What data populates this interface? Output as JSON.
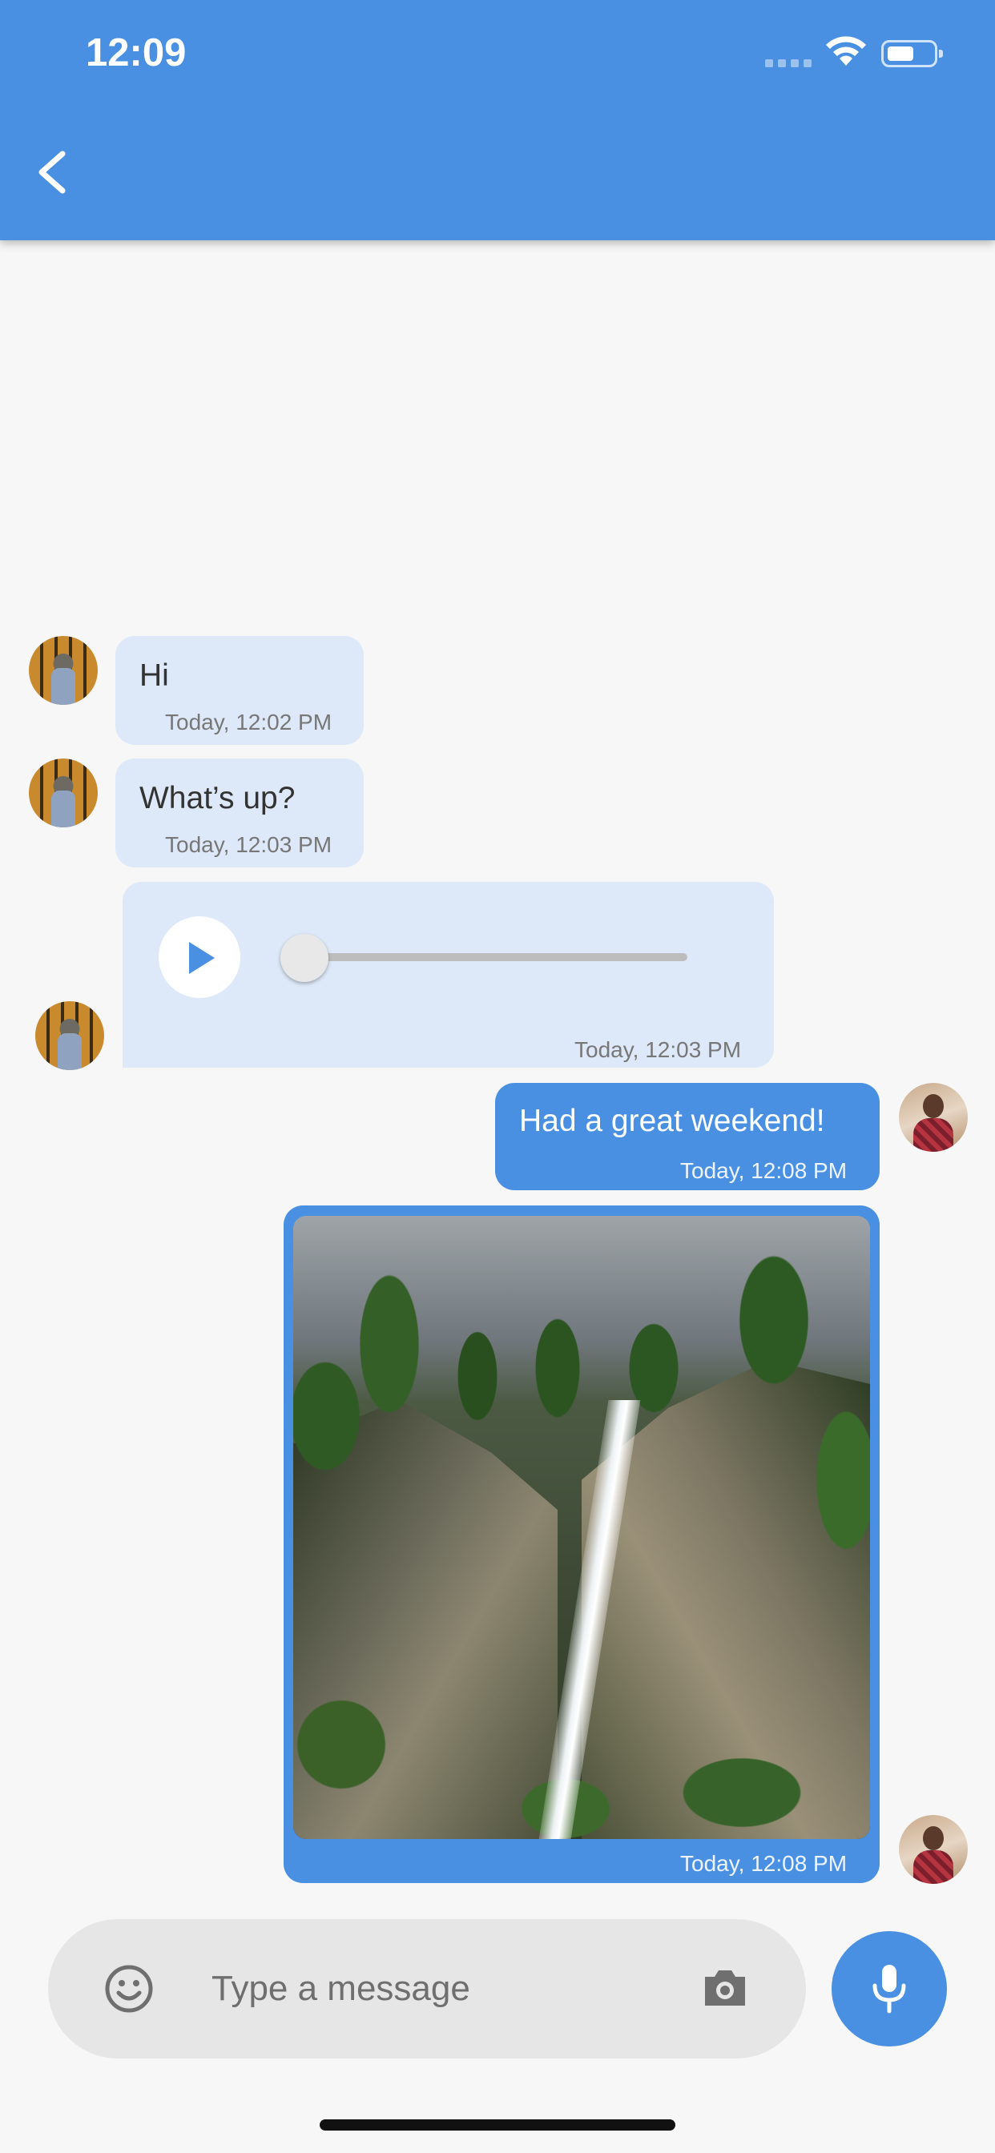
{
  "status_bar": {
    "time": "12:09"
  },
  "app_bar": {
    "back_icon": "chevron-left-icon"
  },
  "messages": [
    {
      "type": "text",
      "direction": "incoming",
      "text": "Hi",
      "time": "Today, 12:02 PM"
    },
    {
      "type": "text",
      "direction": "incoming",
      "text": "What’s up?",
      "time": "Today, 12:03 PM"
    },
    {
      "type": "audio",
      "direction": "incoming",
      "progress": 0,
      "time": "Today, 12:03 PM"
    },
    {
      "type": "text",
      "direction": "outgoing",
      "text": "Had a great weekend!",
      "time": "Today, 12:08 PM"
    },
    {
      "type": "image",
      "direction": "outgoing",
      "image_subject": "waterfall",
      "time": "Today, 12:08 PM"
    }
  ],
  "composer": {
    "placeholder": "Type a message",
    "emoji_icon": "emoji-icon",
    "camera_icon": "camera-icon",
    "mic_icon": "microphone-icon"
  },
  "colors": {
    "primary": "#4a90e2",
    "incoming_bubble": "#dde9f8",
    "background": "#f7f7f7"
  }
}
